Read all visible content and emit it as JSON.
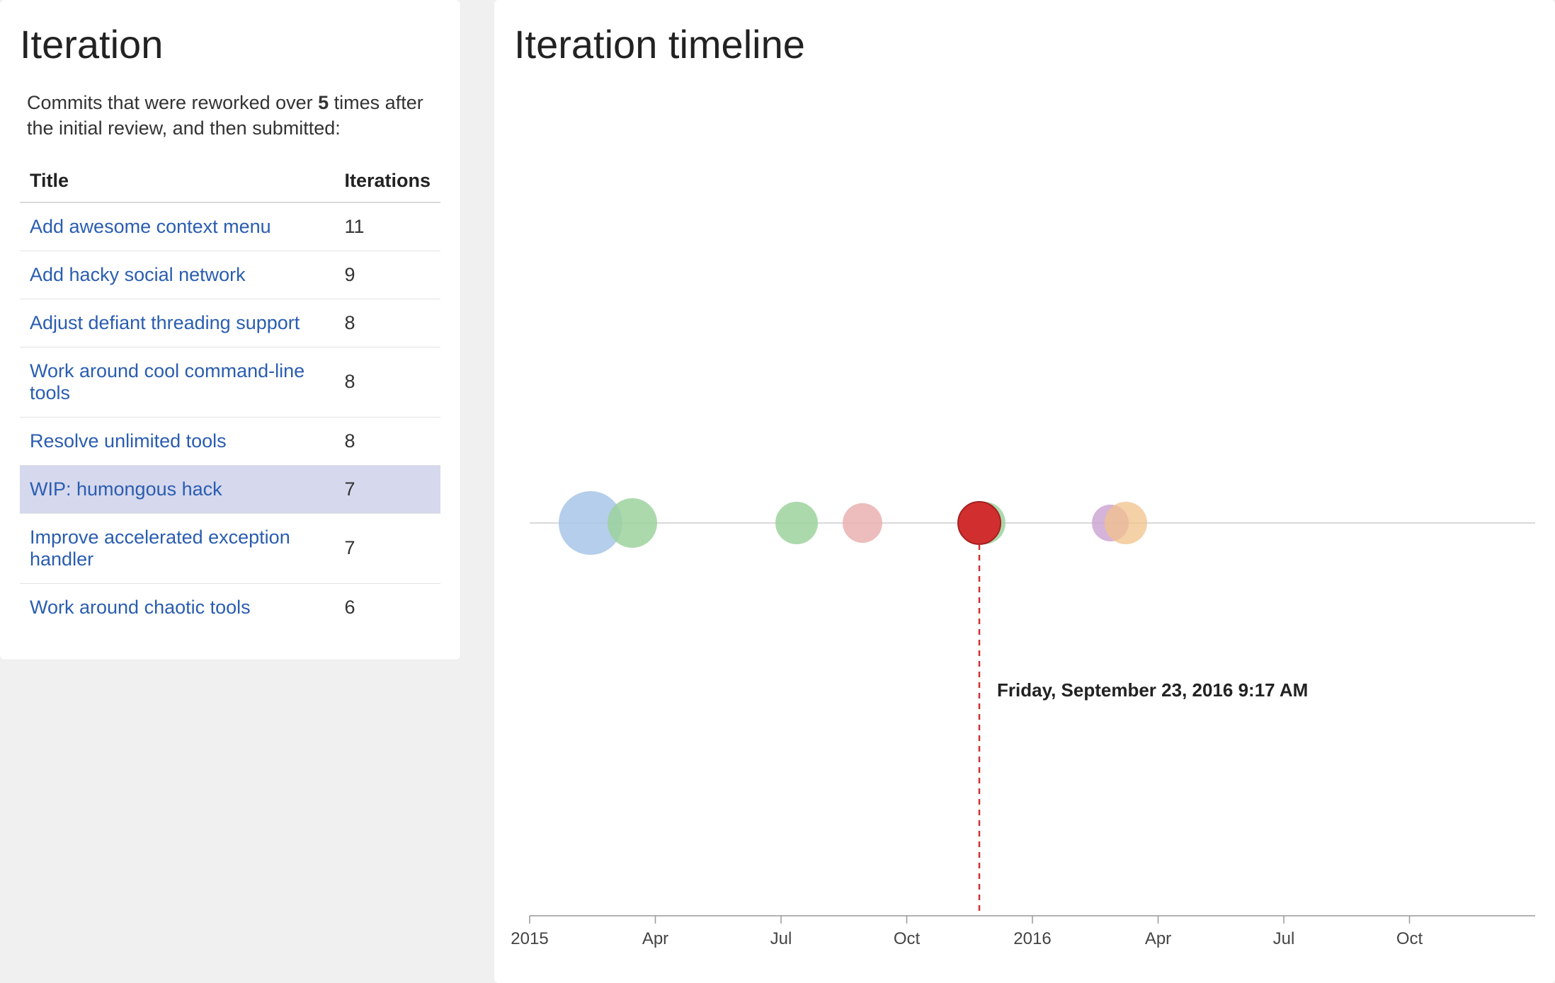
{
  "sidebar": {
    "title": "Iteration",
    "desc_prefix": "Commits that were reworked over ",
    "desc_bold": "5",
    "desc_suffix": " times after the initial review, and then submitted:",
    "headers": {
      "title": "Title",
      "iterations": "Iterations"
    },
    "rows": [
      {
        "title": "Add awesome context menu",
        "count": "11",
        "selected": false
      },
      {
        "title": "Add hacky social network",
        "count": "9",
        "selected": false
      },
      {
        "title": "Adjust defiant threading support",
        "count": "8",
        "selected": false
      },
      {
        "title": "Work around cool command-line tools",
        "count": "8",
        "selected": false
      },
      {
        "title": "Resolve unlimited tools",
        "count": "8",
        "selected": false
      },
      {
        "title": "WIP: humongous hack",
        "count": "7",
        "selected": true
      },
      {
        "title": "Improve accelerated exception handler",
        "count": "7",
        "selected": false
      },
      {
        "title": "Work around chaotic tools",
        "count": "6",
        "selected": false
      }
    ]
  },
  "timeline": {
    "title": "Iteration timeline",
    "callout": "Friday, September 23, 2016 9:17 AM"
  },
  "chart_data": {
    "type": "scatter",
    "title": "Iteration timeline",
    "xlabel": "",
    "ylabel": "",
    "x_axis_type": "time",
    "x_range": [
      "2015-01-01",
      "2016-12-31"
    ],
    "x_ticks": [
      "2015",
      "Apr",
      "Jul",
      "Oct",
      "2016",
      "Apr",
      "Jul",
      "Oct"
    ],
    "points": [
      {
        "date": "2015-03-10",
        "size": 45,
        "color": "#a7c6e8",
        "series": "review"
      },
      {
        "date": "2015-04-10",
        "size": 35,
        "color": "#9cd29e",
        "series": "revision"
      },
      {
        "date": "2015-08-20",
        "size": 30,
        "color": "#9cd29e",
        "series": "revision"
      },
      {
        "date": "2015-09-25",
        "size": 28,
        "color": "#eab0b0",
        "series": "rejected"
      },
      {
        "date": "2016-02-10",
        "size": 30,
        "color": "#9cd29e",
        "series": "revision"
      },
      {
        "date": "2016-02-08",
        "size": 30,
        "color": "#d12f2f",
        "series": "selected",
        "highlight": true
      },
      {
        "date": "2016-05-25",
        "size": 26,
        "color": "#caa1cf",
        "series": "merged-a"
      },
      {
        "date": "2016-06-05",
        "size": 30,
        "color": "#f0c18a",
        "series": "merged-b"
      }
    ],
    "callout_date": "2016-09-23",
    "callout_text": "Friday, September 23, 2016 9:17 AM"
  }
}
